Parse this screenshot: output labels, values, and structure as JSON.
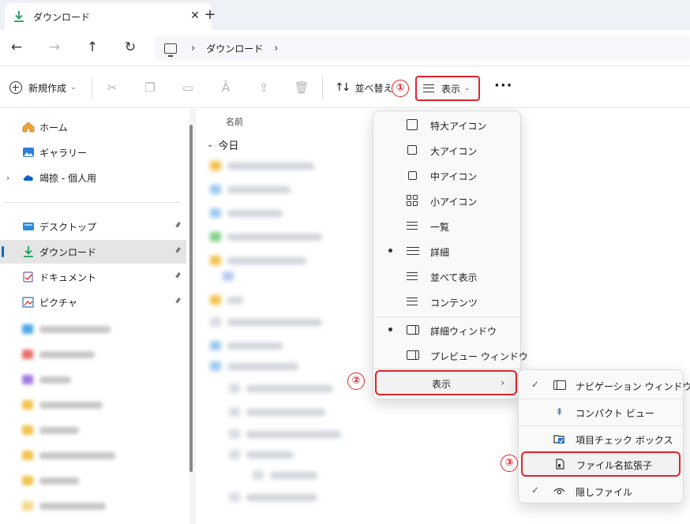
{
  "tab": {
    "title": "ダウンロード",
    "close": "✕",
    "new": "+"
  },
  "nav": {
    "back": "←",
    "forward": "→",
    "up": "↑",
    "refresh": "↻",
    "crumb_sep": "›",
    "crumb": "ダウンロード",
    "crumb_sep2": "›"
  },
  "toolbar": {
    "new_label": "新規作成",
    "new_chevron": "⌄",
    "sort_glyph": "↑↓",
    "sort_label": "並べ替え",
    "view_label": "表示",
    "view_chevron": "⌄",
    "more": "···",
    "icons": [
      "scissors-icon",
      "copy-icon",
      "paste-icon",
      "rename-icon",
      "share-icon",
      "trash-icon"
    ]
  },
  "markers": {
    "one": "①",
    "two": "②",
    "three": "③"
  },
  "sidebar": {
    "expand": "›",
    "top": [
      {
        "label": "ホーム",
        "icon": "home-icon"
      },
      {
        "label": "ギャラリー",
        "icon": "gallery-icon"
      },
      {
        "label": "竭捺 - 個人用",
        "icon": "cloud-icon"
      }
    ],
    "pinned": [
      {
        "label": "デスクトップ",
        "icon": "desktop-icon"
      },
      {
        "label": "ダウンロード",
        "icon": "download-icon"
      },
      {
        "label": "ドキュメント",
        "icon": "document-icon"
      },
      {
        "label": "ピクチャ",
        "icon": "pictures-icon"
      }
    ],
    "pin_glyph": "📌"
  },
  "main": {
    "column_name": "名前",
    "group_chevron": "⌄",
    "group_today": "今日"
  },
  "view_menu": {
    "items": [
      {
        "label": "特大アイコン",
        "icon": "extra-large-icons-icon"
      },
      {
        "label": "大アイコン",
        "icon": "large-icons-icon"
      },
      {
        "label": "中アイコン",
        "icon": "medium-icons-icon"
      },
      {
        "label": "小アイコン",
        "icon": "small-icons-icon"
      },
      {
        "label": "一覧",
        "icon": "list-view-icon"
      },
      {
        "label": "詳細",
        "icon": "details-view-icon",
        "selected": true
      },
      {
        "label": "並べて表示",
        "icon": "tiles-view-icon"
      },
      {
        "label": "コンテンツ",
        "icon": "content-view-icon"
      }
    ],
    "panes": [
      {
        "label": "詳細ウィンドウ",
        "icon": "details-pane-icon",
        "selected": true
      },
      {
        "label": "プレビュー ウィンドウ",
        "icon": "preview-pane-icon"
      }
    ],
    "show": {
      "label": "表示",
      "chevron": "›"
    }
  },
  "show_submenu": {
    "items": [
      {
        "label": "ナビゲーション ウィンドウ",
        "icon": "navigation-pane-icon",
        "check": "✓"
      },
      {
        "label": "コンパクト ビュー",
        "icon": "compact-view-icon",
        "check": ""
      },
      {
        "label": "項目チェック ボックス",
        "icon": "item-checkbox-icon",
        "check": ""
      },
      {
        "label": "ファイル名拡張子",
        "icon": "file-extension-icon",
        "check": ""
      },
      {
        "label": "隠しファイル",
        "icon": "hidden-files-icon",
        "check": "✓"
      }
    ]
  },
  "colors": {
    "accent": "#0067c0",
    "highlight_red": "#e0242b",
    "download_green": "#1a9e5c"
  }
}
